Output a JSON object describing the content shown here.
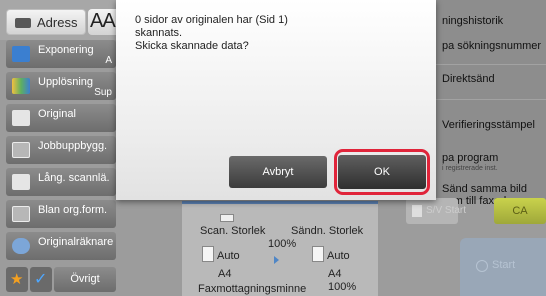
{
  "top": {
    "address_label": "Adress",
    "aa_label": "AA"
  },
  "left_menu": {
    "items": [
      {
        "label": "Exponering",
        "value": "A",
        "icon": "exposure-icon"
      },
      {
        "label": "Upplösning",
        "value": "Sup",
        "icon": "resolution-icon"
      },
      {
        "label": "Original",
        "value": "",
        "icon": "original-icon"
      },
      {
        "label": "Jobbuppbygg.",
        "value": "",
        "icon": "job-build-icon"
      },
      {
        "label": "Lång. scannlä.",
        "value": "",
        "icon": "long-scan-icon"
      },
      {
        "label": "Blan org.form.",
        "value": "",
        "icon": "mixed-size-icon"
      },
      {
        "label": "Originalräknare",
        "value": "",
        "icon": "original-counter-icon"
      }
    ],
    "other_label": "Övrigt"
  },
  "right_menu": {
    "items": [
      {
        "label": "ningshistorik",
        "sub": ""
      },
      {
        "label": "pa sökningsnummer",
        "sub": ""
      },
      {
        "label": "Direktsänd",
        "sub": ""
      },
      {
        "label": "Verifieringsstämpel",
        "sub": ""
      },
      {
        "label": "pa program",
        "sub": "i registrerade inst."
      },
      {
        "label": "Sänd samma bild",
        "sub": ""
      },
      {
        "label": "som till faxadressen",
        "sub": ""
      }
    ],
    "bw_label": "S/V Start",
    "ca_label": "CA",
    "start_label": "Start"
  },
  "info_panel": {
    "scan_size_label": "Scan. Storlek",
    "send_size_label": "Sändn. Storlek",
    "zoom": "100%",
    "scan_mode": "Auto",
    "send_mode": "Auto",
    "scan_paper": "A4",
    "send_paper": "A4",
    "fax_memory_label": "Faxmottagningsminne",
    "fax_memory_value": "100%"
  },
  "dialog": {
    "line1": "0 sidor av originalen har (Sid 1)",
    "line2": "skannats.",
    "line3": "Skicka skannade data?",
    "cancel_label": "Avbryt",
    "ok_label": "OK"
  },
  "colors": {
    "highlight": "#e0243a",
    "accent_blue": "#5b80b2",
    "ca_green": "#b7c04a"
  }
}
